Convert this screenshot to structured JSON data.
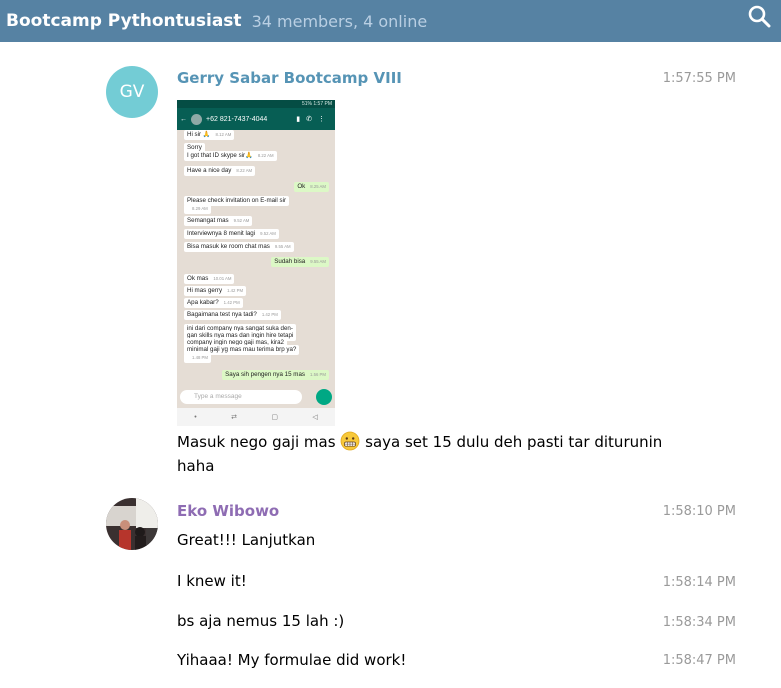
{
  "header": {
    "title": "Bootcamp Pythontusiast",
    "meta": "34 members, 4 online",
    "search_icon": "search-icon"
  },
  "colors": {
    "header_bg": "#5682a3",
    "name_gerry": "#5694b5",
    "name_eko": "#8e6cb3",
    "avatar_gv": "#73ccd5"
  },
  "messages": [
    {
      "author": "Gerry Sabar Bootcamp VIII",
      "initials": "GV",
      "time": "1:57:55 PM",
      "text_line1": "Masuk nego gaji mas",
      "emoji": "grimacing-face",
      "text_line1b": "saya set 15 dulu deh pasti tar diturunin",
      "text_line2": "haha"
    },
    {
      "author": "Eko Wibowo",
      "time": "1:58:10 PM",
      "text": "Great!!! Lanjutkan"
    },
    {
      "time": "1:58:14 PM",
      "text": "I knew it!"
    },
    {
      "time": "1:58:34 PM",
      "text": "bs aja nemus 15 lah :)"
    },
    {
      "time": "1:58:47 PM",
      "text": "Yihaaa! My formulae did work!"
    }
  ],
  "screenshot": {
    "status": "51% 1:57 PM",
    "contact": "+62 821-7437-4044",
    "bubbles": [
      {
        "text": "Hi sir 🙏",
        "time": "8.12 AM",
        "dir": "in"
      },
      {
        "text": "Sorry",
        "time": "",
        "dir": "in"
      },
      {
        "text": "I got that ID skype sir🙏",
        "time": "8.22 AM",
        "dir": "in"
      },
      {
        "text": "Have a nice day",
        "time": "8.22 AM",
        "dir": "in"
      },
      {
        "text": "Ok",
        "time": "8.25 AM",
        "dir": "out"
      },
      {
        "text": "Please check invitation on E-mail sir",
        "time": "",
        "dir": "in"
      },
      {
        "text": "",
        "time": "8.29 AM",
        "dir": "in"
      },
      {
        "text": "Semangat mas",
        "time": "9.52 AM",
        "dir": "in"
      },
      {
        "text": "Interviewnya 8 menit lagi",
        "time": "9.52 AM",
        "dir": "in"
      },
      {
        "text": "Bisa masuk ke room chat mas",
        "time": "9.55 AM",
        "dir": "in"
      },
      {
        "text": "Sudah bisa",
        "time": "9.55 AM",
        "dir": "out"
      },
      {
        "text": "Ok mas",
        "time": "10.01 AM",
        "dir": "in"
      },
      {
        "text": "Hi mas gerry",
        "time": "1.42 PM",
        "dir": "in"
      },
      {
        "text": "Apa kabar?",
        "time": "1.42 PM",
        "dir": "in"
      },
      {
        "text": "Bagaimana test nya tadi?",
        "time": "1.42 PM",
        "dir": "in"
      },
      {
        "text": "ini dari company nya sangat suka den-",
        "time": "",
        "dir": "in"
      },
      {
        "text": "gan skills nya mas dan ingin hire tetapi",
        "time": "",
        "dir": "in"
      },
      {
        "text": "company ingin nego gaji mas, kira2",
        "time": "",
        "dir": "in"
      },
      {
        "text": "minimal gaji yg mas mau terima brp ya?",
        "time": "",
        "dir": "in"
      },
      {
        "text": "",
        "time": "1.48 PM",
        "dir": "in"
      },
      {
        "text": "Saya sih pengen nya 15 mas",
        "time": "1.56 PM",
        "dir": "out"
      }
    ],
    "input_placeholder": "Type a message"
  }
}
